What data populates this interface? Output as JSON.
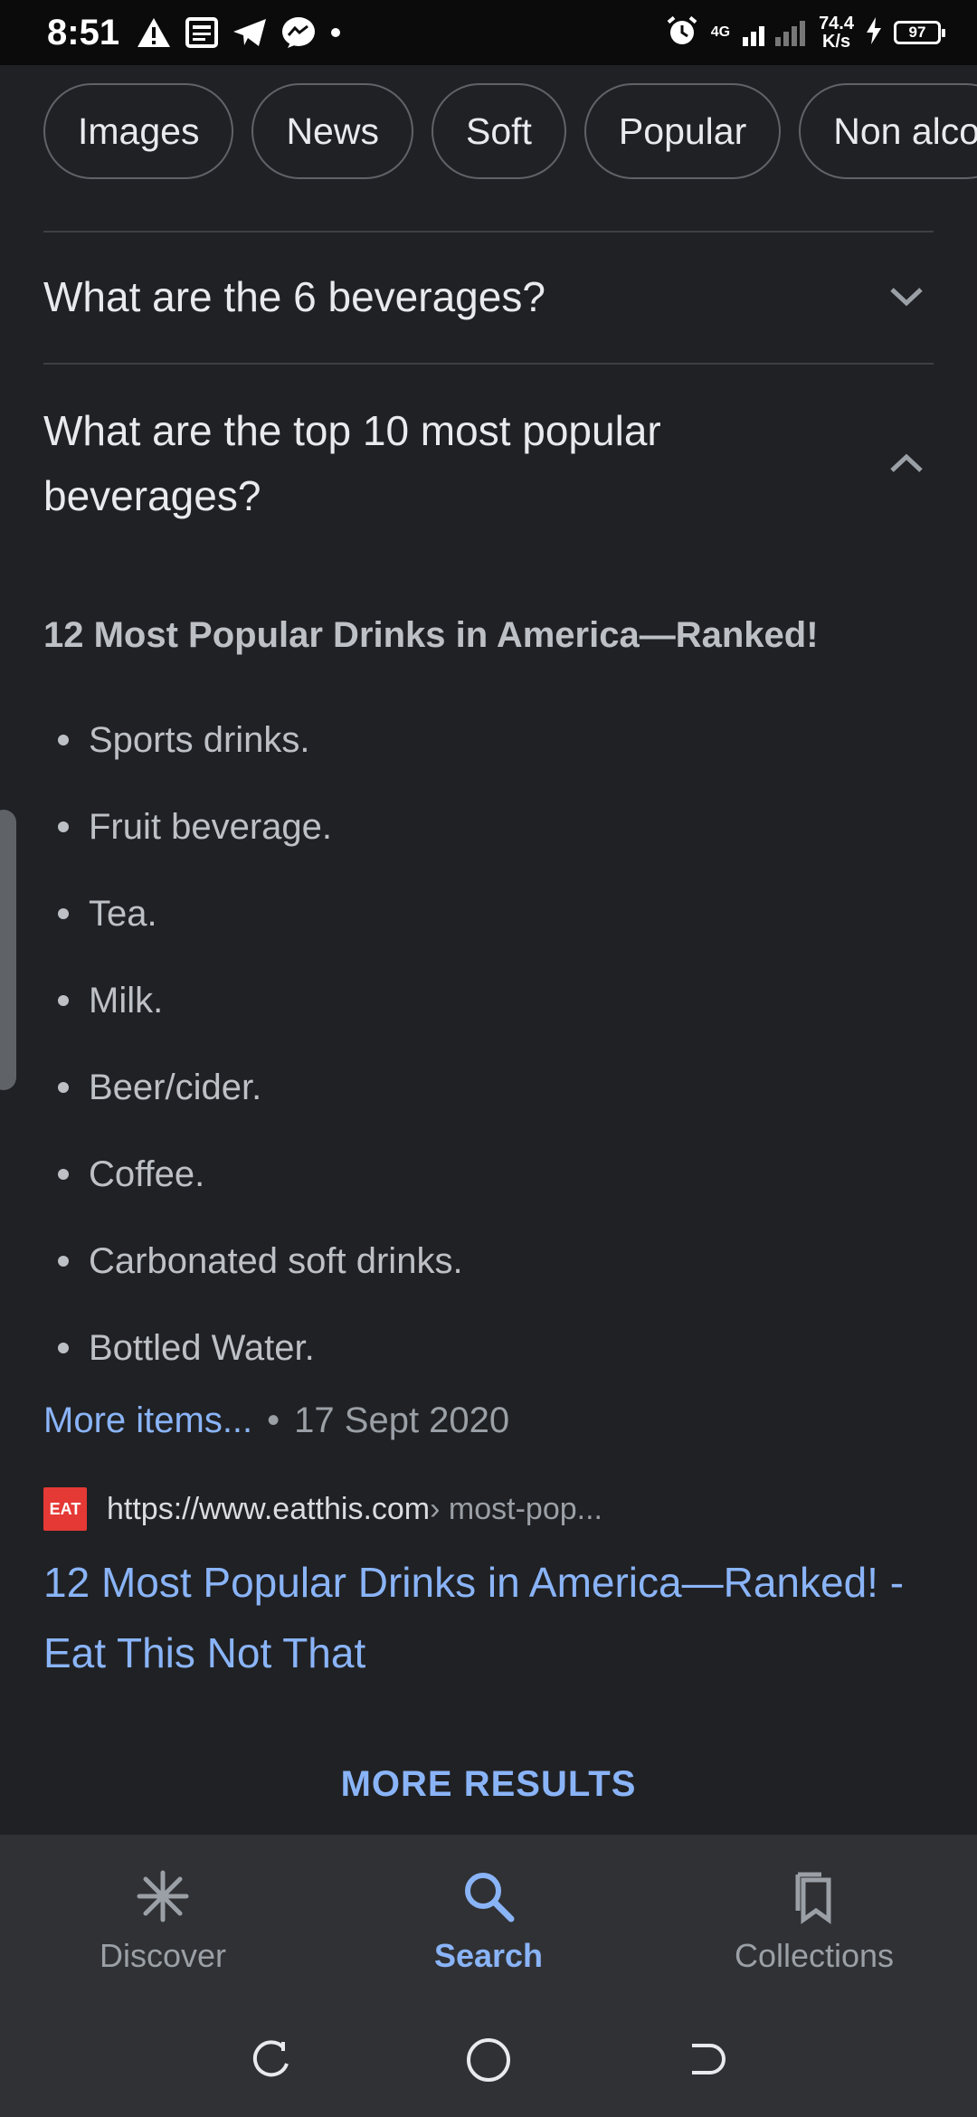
{
  "status_bar": {
    "time": "8:51",
    "speed_value": "74.4",
    "speed_unit": "K/s",
    "network": "4G",
    "battery": "97",
    "icons": [
      "warning-icon",
      "news-icon",
      "telegram-icon",
      "messenger-icon",
      "alarm-icon",
      "signal-icon",
      "charging-icon"
    ]
  },
  "chips": [
    "Images",
    "News",
    "Soft",
    "Popular",
    "Non alco"
  ],
  "faq": {
    "q1": "What are the 6 beverages?",
    "q2": "What are the top 10 most popular beverages?"
  },
  "answer": {
    "title": "12 Most Popular Drinks in America—Ranked!",
    "items": [
      "Sports drinks.",
      "Fruit beverage.",
      "Tea.",
      "Milk.",
      "Beer/cider.",
      "Coffee.",
      "Carbonated soft drinks.",
      "Bottled Water."
    ],
    "more_items": "More items...",
    "date": "17 Sept 2020"
  },
  "source": {
    "favicon_text": "EAT",
    "url": "https://www.eatthis.com",
    "path": " › most-pop...",
    "title": "12 Most Popular Drinks in America—Ranked! - Eat This Not That"
  },
  "more_results": "MORE RESULTS",
  "bottom_nav": {
    "discover": "Discover",
    "search": "Search",
    "collections": "Collections"
  },
  "colors": {
    "background": "#202124",
    "link": "#8ab4f8",
    "nav_bg": "#303134"
  }
}
